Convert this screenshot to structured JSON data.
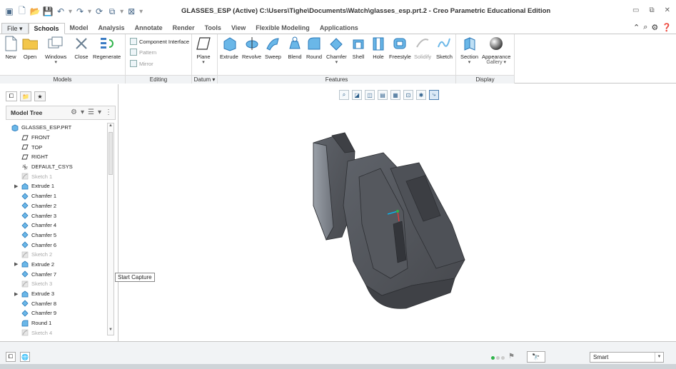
{
  "window": {
    "title": "GLASSES_ESP (Active) C:\\Users\\Tighe\\Documents\\Watch\\glasses_esp.prt.2 - Creo Parametric Educational Edition"
  },
  "tabs": [
    {
      "label": "File ▾"
    },
    {
      "label": "Schools"
    },
    {
      "label": "Model"
    },
    {
      "label": "Analysis"
    },
    {
      "label": "Annotate"
    },
    {
      "label": "Render"
    },
    {
      "label": "Tools"
    },
    {
      "label": "View"
    },
    {
      "label": "Flexible Modeling"
    },
    {
      "label": "Applications"
    }
  ],
  "ribbon": {
    "models": {
      "label": "Models",
      "new": "New",
      "open": "Open",
      "windows": "Windows",
      "close": "Close",
      "regenerate": "Regenerate"
    },
    "editing": {
      "label": "Editing",
      "component_interface": "Component Interface",
      "pattern": "Pattern",
      "mirror": "Mirror"
    },
    "datum": {
      "label": "Datum ▾",
      "plane": "Plane"
    },
    "features": {
      "label": "Features",
      "items": [
        "Extrude",
        "Revolve",
        "Sweep",
        "Blend",
        "Round",
        "Chamfer",
        "Shell",
        "Hole",
        "Freestyle",
        "Solidify",
        "Sketch"
      ]
    },
    "display": {
      "label": "Display",
      "section": "Section",
      "appearance": "Appearance",
      "gallery": "Gallery ▾"
    }
  },
  "model_tree": {
    "title": "Model Tree",
    "items": [
      {
        "label": "GLASSES_ESP.PRT",
        "icon": "part",
        "dim": false,
        "expand": "",
        "indent": 0
      },
      {
        "label": "FRONT",
        "icon": "plane",
        "dim": false,
        "expand": "",
        "indent": 1
      },
      {
        "label": "TOP",
        "icon": "plane",
        "dim": false,
        "expand": "",
        "indent": 1
      },
      {
        "label": "RIGHT",
        "icon": "plane",
        "dim": false,
        "expand": "",
        "indent": 1
      },
      {
        "label": "DEFAULT_CSYS",
        "icon": "csys",
        "dim": false,
        "expand": "",
        "indent": 1
      },
      {
        "label": "Sketch 1",
        "icon": "sketch",
        "dim": true,
        "expand": "",
        "indent": 1
      },
      {
        "label": "Extrude 1",
        "icon": "extrude",
        "dim": false,
        "expand": "▶",
        "indent": 1
      },
      {
        "label": "Chamfer 1",
        "icon": "chamfer",
        "dim": false,
        "expand": "",
        "indent": 1
      },
      {
        "label": "Chamfer 2",
        "icon": "chamfer",
        "dim": false,
        "expand": "",
        "indent": 1
      },
      {
        "label": "Chamfer 3",
        "icon": "chamfer",
        "dim": false,
        "expand": "",
        "indent": 1
      },
      {
        "label": "Chamfer 4",
        "icon": "chamfer",
        "dim": false,
        "expand": "",
        "indent": 1
      },
      {
        "label": "Chamfer 5",
        "icon": "chamfer",
        "dim": false,
        "expand": "",
        "indent": 1
      },
      {
        "label": "Chamfer 6",
        "icon": "chamfer",
        "dim": false,
        "expand": "",
        "indent": 1
      },
      {
        "label": "Sketch 2",
        "icon": "sketch",
        "dim": true,
        "expand": "",
        "indent": 1
      },
      {
        "label": "Extrude 2",
        "icon": "extrude",
        "dim": false,
        "expand": "▶",
        "indent": 1
      },
      {
        "label": "Chamfer 7",
        "icon": "chamfer",
        "dim": false,
        "expand": "",
        "indent": 1
      },
      {
        "label": "Sketch 3",
        "icon": "sketch",
        "dim": true,
        "expand": "",
        "indent": 1
      },
      {
        "label": "Extrude 3",
        "icon": "extrude",
        "dim": false,
        "expand": "▶",
        "indent": 1
      },
      {
        "label": "Chamfer 8",
        "icon": "chamfer",
        "dim": false,
        "expand": "",
        "indent": 1
      },
      {
        "label": "Chamfer 9",
        "icon": "chamfer",
        "dim": false,
        "expand": "",
        "indent": 1
      },
      {
        "label": "Round 1",
        "icon": "round",
        "dim": false,
        "expand": "",
        "indent": 1
      },
      {
        "label": "Sketch 4",
        "icon": "sketch",
        "dim": true,
        "expand": "",
        "indent": 1
      }
    ]
  },
  "tooltip": {
    "text": "Start Capture"
  },
  "status": {
    "filter_value": "Smart"
  },
  "colors": {
    "accent": "#2a6db0",
    "part_gray": "#5b5d63",
    "highlight_green": "#2fb34a"
  }
}
